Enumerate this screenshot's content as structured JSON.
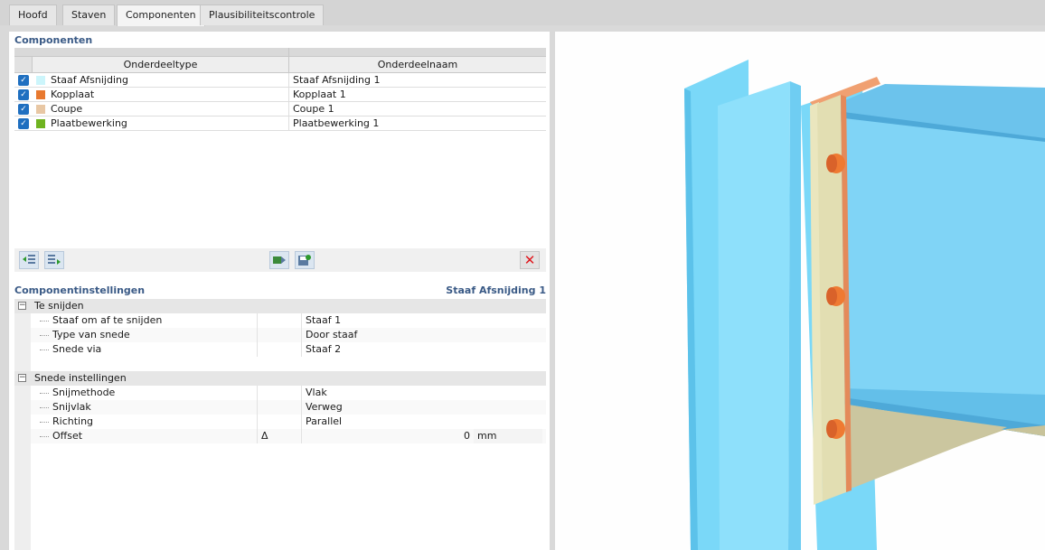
{
  "tabs": [
    {
      "label": "Hoofd",
      "active": false
    },
    {
      "label": "Staven",
      "active": false
    },
    {
      "label": "Componenten",
      "active": true
    },
    {
      "label": "Plausibiliteitscontrole",
      "active": false
    }
  ],
  "components": {
    "header": "Componenten",
    "columns": [
      "Onderdeeltype",
      "Onderdeelnaam"
    ],
    "rows": [
      {
        "type": "Staaf Afsnijding",
        "name": "Staaf Afsnijding 1",
        "color": "#ccf5fb"
      },
      {
        "type": "Kopplaat",
        "name": "Kopplaat 1",
        "color": "#e8792f"
      },
      {
        "type": "Coupe",
        "name": "Coupe 1",
        "color": "#e8c7a4"
      },
      {
        "type": "Plaatbewerking",
        "name": "Plaatbewerking 1",
        "color": "#6fb320"
      }
    ]
  },
  "settings": {
    "header": "Componentinstellingen",
    "selected": "Staaf Afsnijding 1",
    "groups": [
      {
        "title": "Te snijden",
        "rows": [
          {
            "name": "Staaf om af te snijden",
            "symbol": "",
            "value": "Staaf 1",
            "unit": ""
          },
          {
            "name": "Type van snede",
            "symbol": "",
            "value": "Door staaf",
            "unit": ""
          },
          {
            "name": "Snede via",
            "symbol": "",
            "value": "Staaf 2",
            "unit": ""
          }
        ]
      },
      {
        "title": "Snede instellingen",
        "rows": [
          {
            "name": "Snijmethode",
            "symbol": "",
            "value": "Vlak",
            "unit": ""
          },
          {
            "name": "Snijvlak",
            "symbol": "",
            "value": "Verweg",
            "unit": ""
          },
          {
            "name": "Richting",
            "symbol": "",
            "value": "Parallel",
            "unit": ""
          },
          {
            "name": "Offset",
            "symbol": "Δ",
            "value": "0",
            "unit": "mm"
          }
        ]
      }
    ]
  },
  "colors": {
    "accent": "#3a5a86",
    "checkbox": "#1f6fc0",
    "delete": "#e0161d",
    "steel_blue": "#7fd9f8",
    "plate": "#e1ddb0",
    "bolt": "#ef7a32"
  },
  "icons": {
    "toolbar": [
      "move-left-icon",
      "move-right-icon",
      "transfer-icon",
      "save-settings-icon",
      "delete-icon"
    ]
  }
}
